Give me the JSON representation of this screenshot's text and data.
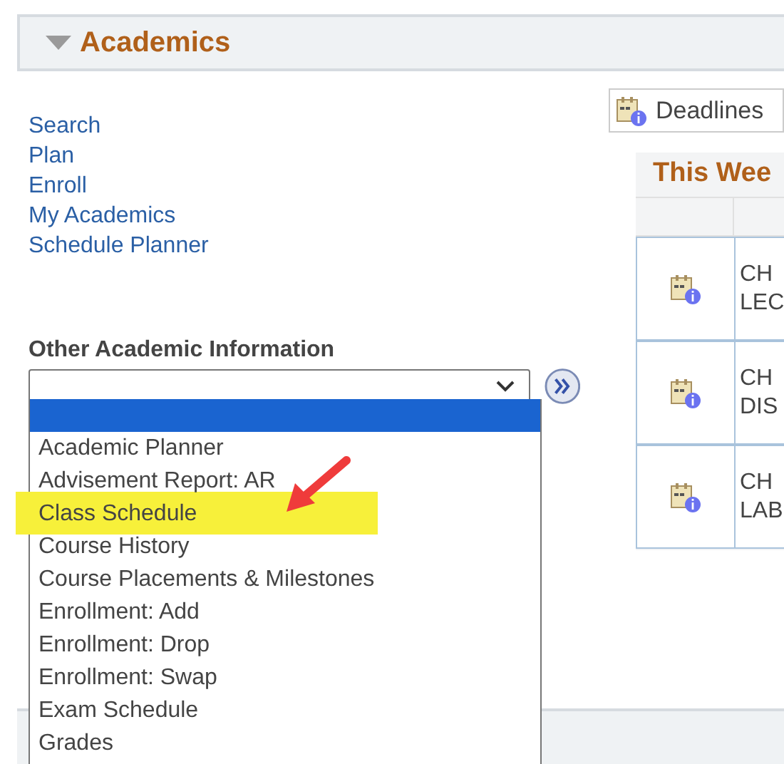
{
  "section": {
    "title": "Academics",
    "expanded": true
  },
  "links": [
    {
      "label": "Search"
    },
    {
      "label": "Plan"
    },
    {
      "label": "Enroll"
    },
    {
      "label": "My Academics"
    },
    {
      "label": "Schedule Planner"
    }
  ],
  "other_info": {
    "label": "Other Academic Information",
    "options": [
      {
        "selected": true,
        "highlighted": false
      },
      {
        "label": "Academic Planner",
        "selected": false,
        "highlighted": false
      },
      {
        "label": "Advisement Report: AR",
        "selected": false,
        "highlighted": false
      },
      {
        "label": "Class Schedule",
        "selected": false,
        "highlighted": true
      },
      {
        "label": "Course History",
        "selected": false,
        "highlighted": false
      },
      {
        "label": "Course Placements & Milestones",
        "selected": false,
        "highlighted": false
      },
      {
        "label": "Enrollment: Add",
        "selected": false,
        "highlighted": false
      },
      {
        "label": "Enrollment: Drop",
        "selected": false,
        "highlighted": false
      },
      {
        "label": "Enrollment: Swap",
        "selected": false,
        "highlighted": false
      },
      {
        "label": "Exam Schedule",
        "selected": false,
        "highlighted": false
      },
      {
        "label": "Grades",
        "selected": false,
        "highlighted": false
      }
    ]
  },
  "deadlines_button": {
    "label": "Deadlines"
  },
  "this_week": {
    "title": "This Wee",
    "rows": [
      {
        "lines": [
          "CH",
          "LEC"
        ]
      },
      {
        "lines": [
          "CH",
          "DIS"
        ]
      },
      {
        "lines": [
          "CH",
          "LAB"
        ]
      }
    ]
  }
}
